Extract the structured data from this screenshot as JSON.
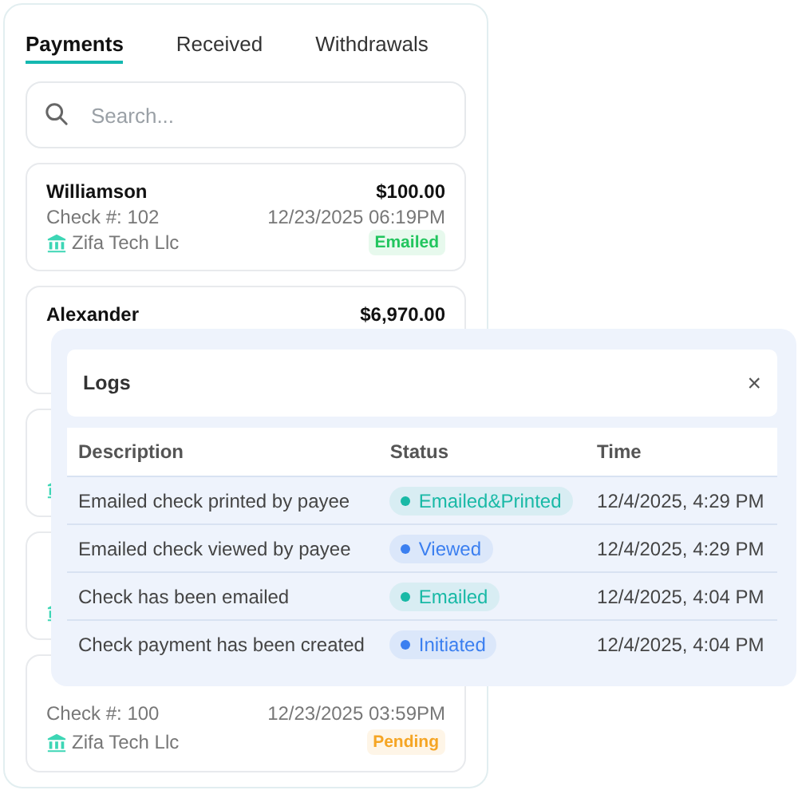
{
  "tabs": [
    {
      "label": "Payments",
      "selected": true
    },
    {
      "label": "Received",
      "selected": false
    },
    {
      "label": "Withdrawals",
      "selected": false
    }
  ],
  "search": {
    "placeholder": "Search..."
  },
  "cards": [
    {
      "name": "Williamson",
      "amount": "$100.00",
      "check": "Check #: 102",
      "date": "12/23/2025 06:19PM",
      "bank": "Zifa Tech Llc",
      "status": "Emailed",
      "color": "#22c55e"
    },
    {
      "name": "Alexander",
      "amount": "$6,970.00"
    },
    {
      "kind": "covered"
    },
    {
      "kind": "covered"
    },
    {
      "check": "Check #: 100",
      "date": "12/23/2025 03:59PM",
      "bank": "Zifa Tech Llc",
      "status": "Pending",
      "color": "#f5a524"
    }
  ],
  "logs": {
    "title": "Logs",
    "close": "×",
    "columns": [
      "Description",
      "Status",
      "Time"
    ],
    "rows": [
      {
        "description": "Emailed check printed by payee",
        "status": "Emailed&Printed",
        "color": "#19b9a6",
        "time": "12/4/2025, 4:29 PM"
      },
      {
        "description": "Emailed check viewed by payee",
        "status": "Viewed",
        "color": "#3b7ff0",
        "time": "12/4/2025, 4:29 PM"
      },
      {
        "description": "Check has been emailed",
        "status": "Emailed",
        "color": "#19b9a6",
        "time": "12/4/2025, 4:04 PM"
      },
      {
        "description": "Check payment has been created",
        "status": "Initiated",
        "color": "#3b7ff0",
        "time": "12/4/2025, 4:04 PM"
      }
    ]
  }
}
